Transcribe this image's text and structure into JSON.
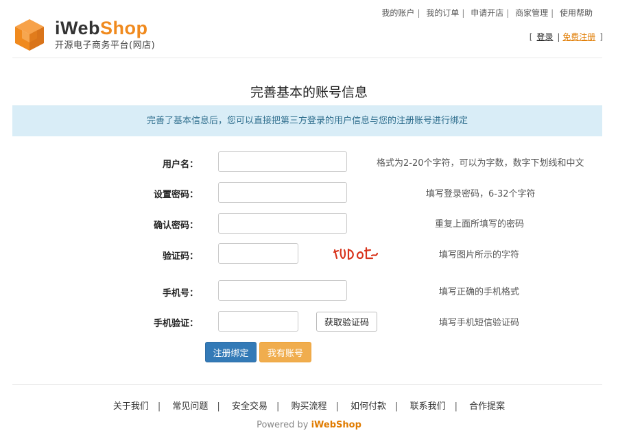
{
  "header": {
    "brand_prefix": "iWeb",
    "brand_suffix": "Shop",
    "tagline": "开源电子商务平台(网店)",
    "top_nav": [
      "我的账户",
      "我的订单",
      "申请开店",
      "商家管理",
      "使用帮助"
    ],
    "login_label": "登录",
    "register_label": "免费注册"
  },
  "page_title": "完善基本的账号信息",
  "info_banner": "完善了基本信息后，您可以直接把第三方登录的用户信息与您的注册账号进行绑定",
  "form": {
    "username": {
      "label": "用户名：",
      "value": "",
      "hint": "格式为2-20个字符，可以为字数，数字下划线和中文"
    },
    "password": {
      "label": "设置密码：",
      "value": "",
      "hint": "填写登录密码，6-32个字符"
    },
    "confirm_password": {
      "label": "确认密码：",
      "value": "",
      "hint": "重复上面所填写的密码"
    },
    "captcha": {
      "label": "验证码：",
      "value": "",
      "hint": "填写图片所示的字符"
    },
    "mobile": {
      "label": "手机号：",
      "value": "",
      "hint": "填写正确的手机格式"
    },
    "sms_code": {
      "label": "手机验证：",
      "value": "",
      "hint": "填写手机短信验证码",
      "button": "获取验证码"
    },
    "submit_label": "注册绑定",
    "have_account_label": "我有账号"
  },
  "colors": {
    "brand_orange": "#f08a1e",
    "primary": "#337ab7",
    "warning": "#f0ad4e",
    "banner_bg": "#d9edf7",
    "banner_text": "#31708f"
  },
  "footer": {
    "links": [
      "关于我们",
      "常见问题",
      "安全交易",
      "购买流程",
      "如何付款",
      "联系我们",
      "合作提案"
    ],
    "powered_by": "Powered by",
    "powered_brand": "iWebShop"
  }
}
